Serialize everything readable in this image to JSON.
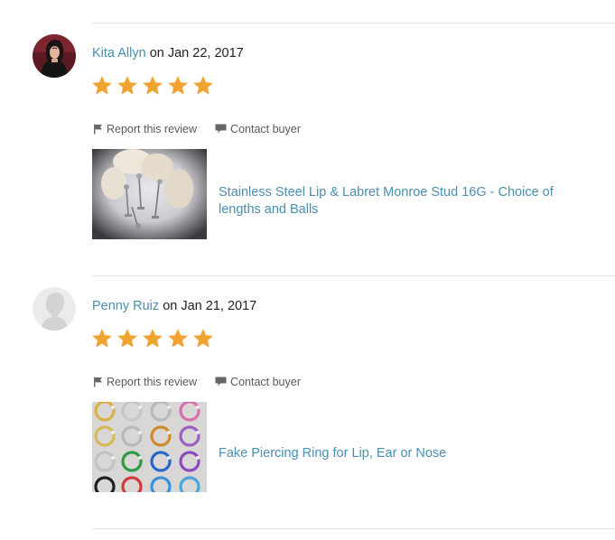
{
  "on_word": "on",
  "colors": {
    "link": "#4a8eb0",
    "star": "#f1a332",
    "divider": "#e1e3df",
    "meta_text": "#595959"
  },
  "reviews": [
    {
      "reviewer": "Kita Allyn",
      "date": "Jan 22, 2017",
      "rating": 5,
      "avatar": "user-photo",
      "actions": {
        "report": "Report this review",
        "contact": "Contact buyer"
      },
      "listing": {
        "title": "Stainless Steel Lip & Labret Monroe Stud 16G - Choice of lengths and Balls",
        "image": "steel-stud-photo"
      }
    },
    {
      "reviewer": "Penny Ruiz",
      "date": "Jan 21, 2017",
      "rating": 5,
      "avatar": "default-avatar",
      "actions": {
        "report": "Report this review",
        "contact": "Contact buyer"
      },
      "listing": {
        "title": "Fake Piercing Ring for Lip, Ear or Nose",
        "image": "colored-rings-photo"
      }
    }
  ]
}
